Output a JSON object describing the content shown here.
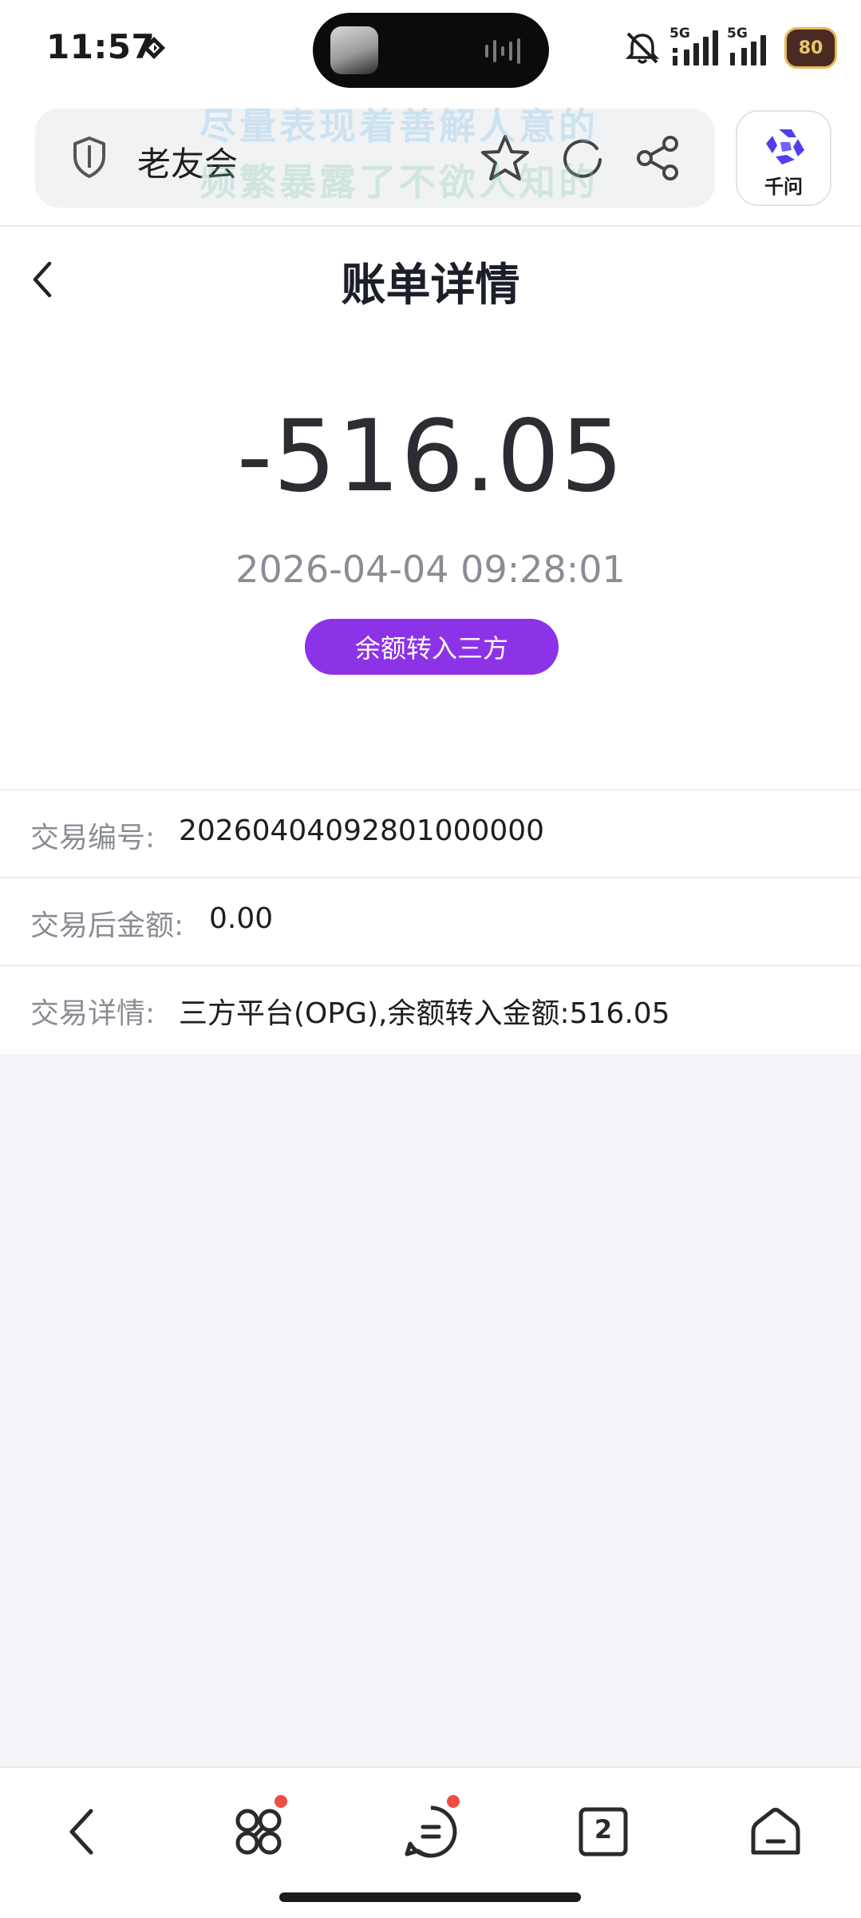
{
  "status_bar": {
    "time": "11:57",
    "signal_1_label": "5G",
    "signal_2_label": "5G",
    "battery": "80"
  },
  "browser": {
    "site_name": "老友会",
    "watermark_line1": "尽量表现着善解人意的",
    "watermark_line2": "频繁暴露了不欲人知的",
    "ai_label": "千问",
    "ai_color": "#4f3ff0"
  },
  "page": {
    "title": "账单详情"
  },
  "transaction": {
    "amount": "-516.05",
    "datetime": "2026-04-04 09:28:01",
    "type_badge": "余额转入三方",
    "badge_color": "#8c33e8"
  },
  "details": [
    {
      "label": "交易编号:",
      "value": "20260404092801000000"
    },
    {
      "label": "交易后金额:",
      "value": "0.00"
    },
    {
      "label": "交易详情:",
      "value": "三方平台(OPG),余额转入金额:516.05"
    }
  ],
  "bottom_nav": {
    "tab_count": "2"
  }
}
